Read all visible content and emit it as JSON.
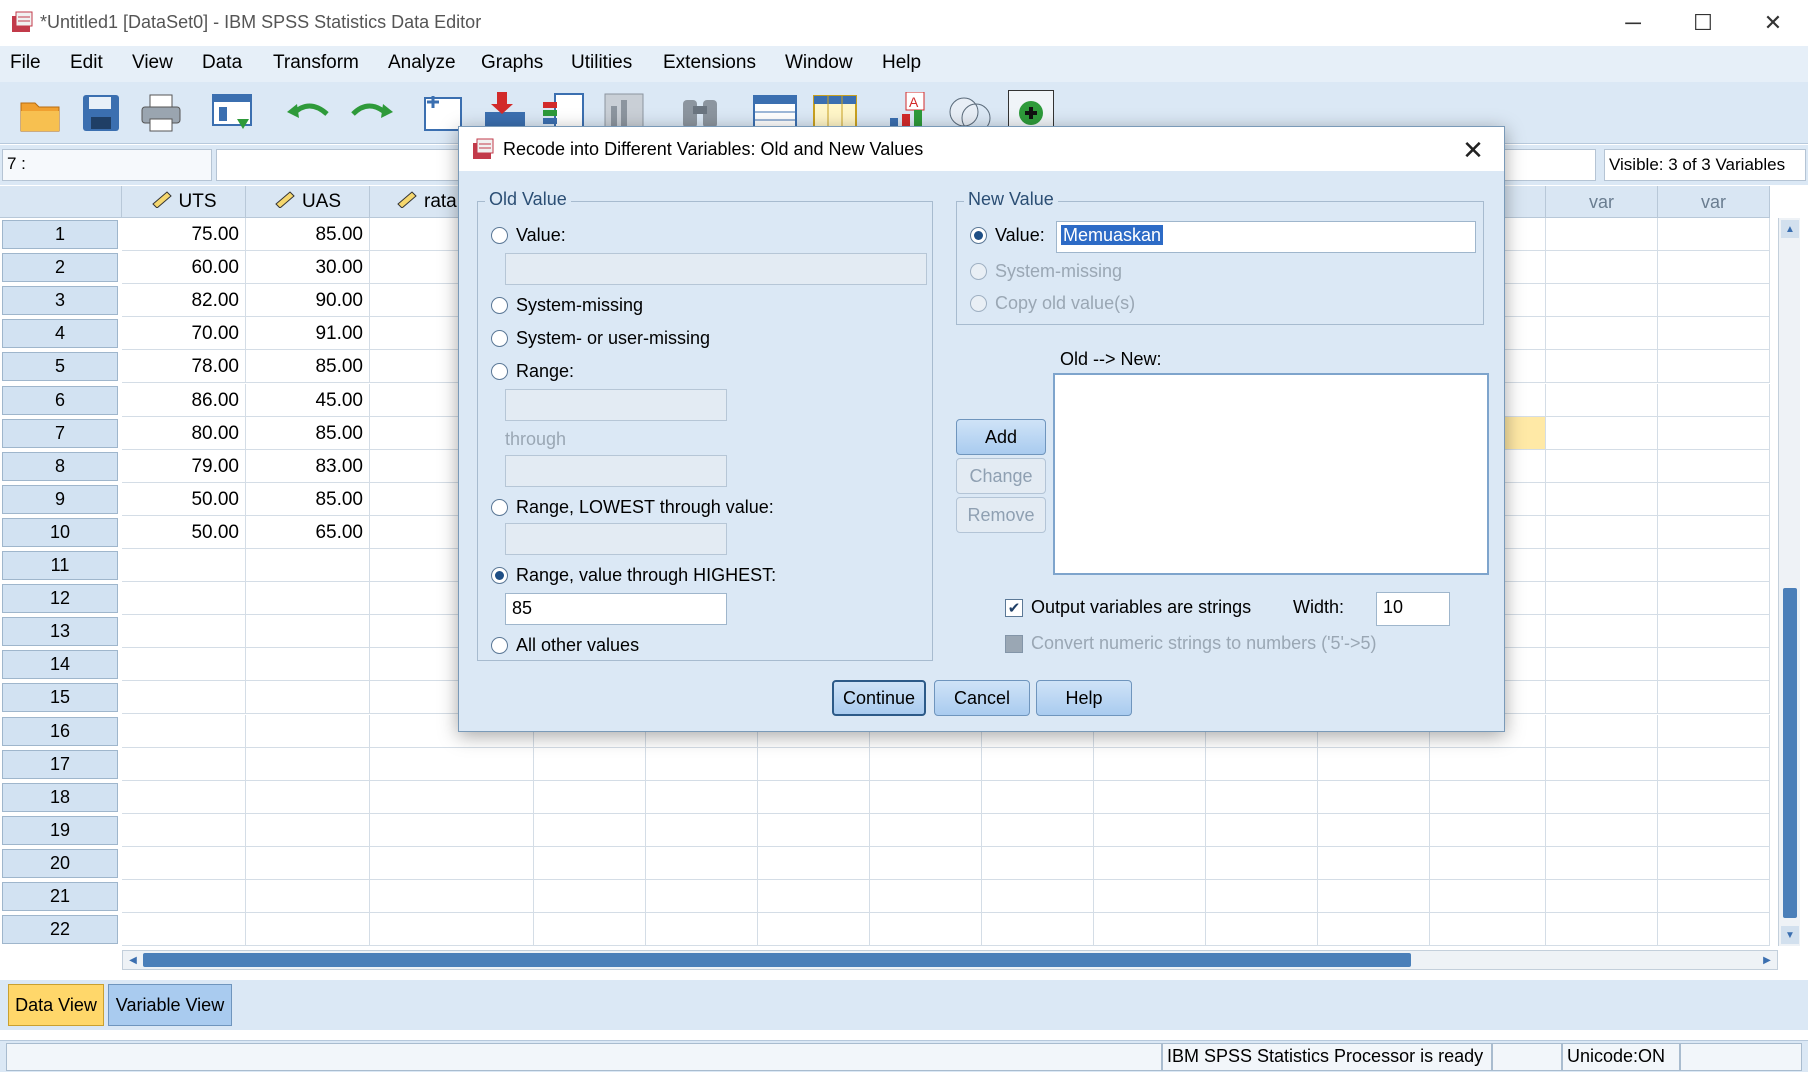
{
  "window": {
    "title": "*Untitled1 [DataSet0] - IBM SPSS Statistics Data Editor",
    "minimize": "─",
    "maximize": "☐",
    "close": "✕"
  },
  "menu": [
    "File",
    "Edit",
    "View",
    "Data",
    "Transform",
    "Analyze",
    "Graphs",
    "Utilities",
    "Extensions",
    "Window",
    "Help"
  ],
  "toolbar_icons": [
    "open-icon",
    "save-icon",
    "print-icon",
    "dialog-recall-icon",
    "undo-icon",
    "redo-icon",
    "goto-case-icon",
    "goto-variable-icon",
    "variables-icon",
    "run-descriptives-icon",
    "find-icon",
    "insert-cases-icon",
    "insert-variable-icon",
    "split-file-icon",
    "weight-cases-icon",
    "select-cases-icon",
    "value-labels-icon",
    "use-sets-icon"
  ],
  "cell_editor": {
    "cell_ref": "7 :",
    "value": "",
    "visible": "Visible: 3 of 3 Variables"
  },
  "grid": {
    "columns": [
      "UTS",
      "UAS",
      "rata",
      "var",
      "var"
    ],
    "rows": [
      {
        "n": "1",
        "UTS": "75.00",
        "UAS": "85.00"
      },
      {
        "n": "2",
        "UTS": "60.00",
        "UAS": "30.00"
      },
      {
        "n": "3",
        "UTS": "82.00",
        "UAS": "90.00"
      },
      {
        "n": "4",
        "UTS": "70.00",
        "UAS": "91.00"
      },
      {
        "n": "5",
        "UTS": "78.00",
        "UAS": "85.00"
      },
      {
        "n": "6",
        "UTS": "86.00",
        "UAS": "45.00"
      },
      {
        "n": "7",
        "UTS": "80.00",
        "UAS": "85.00"
      },
      {
        "n": "8",
        "UTS": "79.00",
        "UAS": "83.00"
      },
      {
        "n": "9",
        "UTS": "50.00",
        "UAS": "85.00"
      },
      {
        "n": "10",
        "UTS": "50.00",
        "UAS": "65.00"
      },
      {
        "n": "11"
      },
      {
        "n": "12"
      },
      {
        "n": "13"
      },
      {
        "n": "14"
      },
      {
        "n": "15"
      },
      {
        "n": "16"
      },
      {
        "n": "17"
      },
      {
        "n": "18"
      },
      {
        "n": "19"
      },
      {
        "n": "20"
      },
      {
        "n": "21"
      },
      {
        "n": "22"
      }
    ]
  },
  "tabs": {
    "data_view": "Data View",
    "variable_view": "Variable View"
  },
  "status": {
    "processor": "IBM SPSS Statistics Processor is ready",
    "unicode": "Unicode:ON"
  },
  "dialog": {
    "title": "Recode into Different Variables: Old and New Values",
    "old_value": {
      "legend": "Old Value",
      "value_label": "Value:",
      "value_input": "",
      "system_missing": "System-missing",
      "system_or_user_missing": "System- or user-missing",
      "range_label": "Range:",
      "through": "through",
      "range_lowest": "Range, LOWEST through value:",
      "range_highest": "Range, value through HIGHEST:",
      "range_highest_value": "85",
      "all_other": "All other values"
    },
    "new_value": {
      "legend": "New Value",
      "value_label": "Value:",
      "value_input": "Memuaskan",
      "system_missing": "System-missing",
      "copy_old": "Copy old value(s)"
    },
    "old_new_label": "Old --> New:",
    "buttons": {
      "add": "Add",
      "change": "Change",
      "remove": "Remove",
      "continue": "Continue",
      "cancel": "Cancel",
      "help": "Help"
    },
    "output_strings": "Output variables are strings",
    "width_label": "Width:",
    "width_value": "10",
    "convert_numeric": "Convert numeric strings to numbers ('5'->5)"
  }
}
